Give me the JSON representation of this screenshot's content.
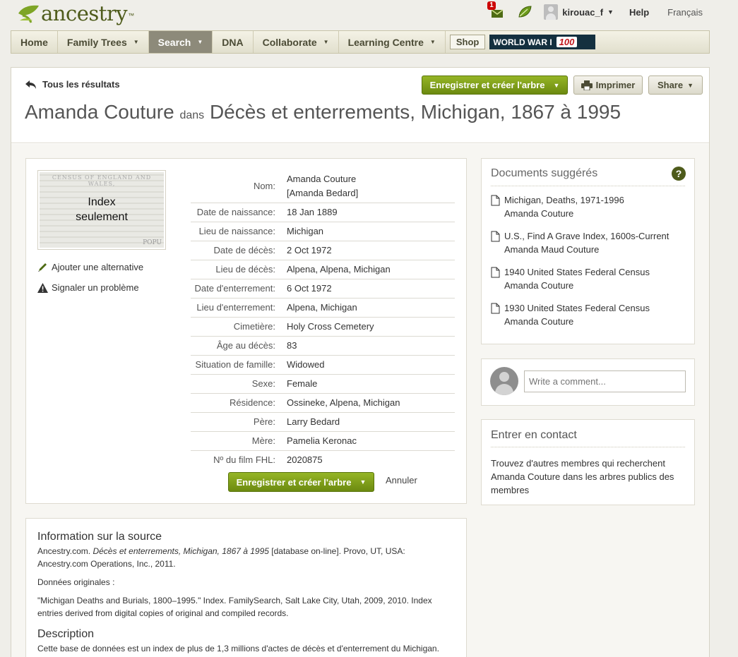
{
  "header": {
    "logo_text": "ancestry",
    "logo_tm": "™",
    "message_count": "1",
    "username": "kirouac_f",
    "help": "Help",
    "language": "Français"
  },
  "nav": {
    "items": [
      {
        "label": "Home",
        "has_menu": false
      },
      {
        "label": "Family Trees",
        "has_menu": true
      },
      {
        "label": "Search",
        "has_menu": true
      },
      {
        "label": "DNA",
        "has_menu": false
      },
      {
        "label": "Collaborate",
        "has_menu": true
      },
      {
        "label": "Learning Centre",
        "has_menu": true
      }
    ],
    "shop": "Shop",
    "ww1_text": "WORLD WAR I",
    "ww1_badge": "100"
  },
  "record_header": {
    "back": "Tous les résultats",
    "name": "Amanda Couture",
    "dans": "dans",
    "collection": "Décès et enterrements, Michigan, 1867 à 1995",
    "save_button": "Enregistrer et créer l'arbre",
    "print_button": "Imprimer",
    "share_button": "Share"
  },
  "record": {
    "thumb_header": "CENSUS OF ENGLAND AND WALES,",
    "thumb_label_1": "Index",
    "thumb_label_2": "seulement",
    "thumb_corner": "POPU",
    "add_alternative": "Ajouter une alternative",
    "report_problem": "Signaler un problème",
    "facts": [
      {
        "label": "Nom:",
        "value": "Amanda Couture",
        "value2": "[Amanda Bedard]"
      },
      {
        "label": "Date de naissance:",
        "value": "18 Jan 1889"
      },
      {
        "label": "Lieu de naissance:",
        "value": "Michigan"
      },
      {
        "label": "Date de décès:",
        "value": "2 Oct 1972"
      },
      {
        "label": "Lieu de décès:",
        "value": "Alpena, Alpena, Michigan"
      },
      {
        "label": "Date d'enterrement:",
        "value": "6 Oct 1972"
      },
      {
        "label": "Lieu d'enterrement:",
        "value": "Alpena, Michigan"
      },
      {
        "label": "Cimetière:",
        "value": "Holy Cross Cemetery"
      },
      {
        "label": "Âge au décès:",
        "value": "83"
      },
      {
        "label": "Situation de famille:",
        "value": "Widowed"
      },
      {
        "label": "Sexe:",
        "value": "Female"
      },
      {
        "label": "Résidence:",
        "value": "Ossineke, Alpena, Michigan"
      },
      {
        "label": "Père:",
        "value": "Larry Bedard"
      },
      {
        "label": "Mère:",
        "value": "Pamelia Keronac"
      },
      {
        "label": "Nº du film FHL:",
        "value": "2020875"
      }
    ],
    "save_button": "Enregistrer et créer l'arbre",
    "cancel": "Annuler"
  },
  "source": {
    "heading": "Information sur la source",
    "citation_prefix": "Ancestry.com. ",
    "citation_title": "Décès et enterrements, Michigan, 1867 à 1995",
    "citation_suffix": " [database on-line]. Provo, UT, USA: Ancestry.com Operations, Inc., 2011.",
    "original_label": "Données originales :",
    "original_text": "\"Michigan Deaths and Burials, 1800–1995.\" Index. FamilySearch, Salt Lake City, Utah, 2009, 2010. Index entries derived from digital copies of original and compiled records.",
    "description_heading": "Description",
    "description_text": "Cette base de données est un index de plus de 1,3 millions d'actes de décès et d'enterrement du Michigan."
  },
  "suggested": {
    "title": "Documents suggérés",
    "help": "?",
    "items": [
      {
        "title": "Michigan, Deaths, 1971-1996",
        "name": "Amanda Couture"
      },
      {
        "title": "U.S., Find A Grave Index, 1600s-Current",
        "name": "Amanda Maud Couture"
      },
      {
        "title": "1940 United States Federal Census",
        "name": "Amanda Couture"
      },
      {
        "title": "1930 United States Federal Census",
        "name": "Amanda Couture"
      }
    ]
  },
  "comment": {
    "placeholder": "Write a comment..."
  },
  "contact": {
    "title": "Entrer en contact",
    "text": "Trouvez d'autres membres qui recherchent Amanda Couture dans les arbres publics des membres"
  },
  "colors": {
    "brand_green": "#4e5b1b",
    "button_green": "#7d9c18",
    "nav_active": "#8d8a7a"
  }
}
